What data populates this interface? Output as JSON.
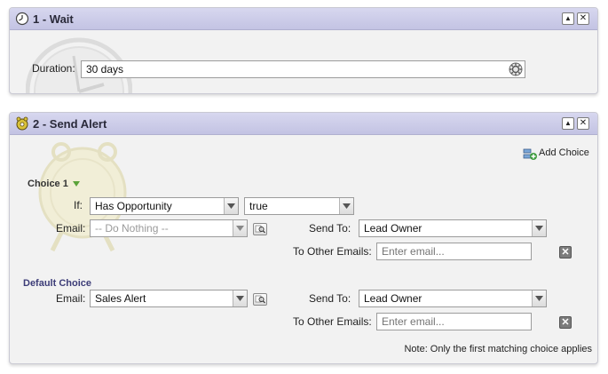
{
  "wait_panel": {
    "title": "1 - Wait",
    "minimize_glyph": "▲",
    "close_glyph": "✕",
    "duration_label": "Duration:",
    "duration_value": "30 days",
    "icons": [
      "clock-icon",
      "gear-icon"
    ]
  },
  "alert_panel": {
    "title": "2 - Send Alert",
    "minimize_glyph": "▲",
    "close_glyph": "✕",
    "add_choice_label": "Add Choice",
    "choice1": {
      "heading": "Choice 1",
      "if_label": "If:",
      "if_condition": "Has Opportunity",
      "if_value": "true",
      "email_label": "Email:",
      "email_value": "-- Do Nothing --",
      "send_to_label": "Send To:",
      "send_to_value": "Lead Owner",
      "other_emails_label": "To Other Emails:",
      "other_emails_placeholder": "Enter email..."
    },
    "default_choice": {
      "heading": "Default Choice",
      "email_label": "Email:",
      "email_value": "Sales Alert",
      "send_to_label": "Send To:",
      "send_to_value": "Lead Owner",
      "other_emails_label": "To Other Emails:",
      "other_emails_placeholder": "Enter email..."
    },
    "note": "Note: Only the first matching choice applies",
    "remove_glyph": "✕",
    "icons": [
      "alarm-bell-icon",
      "add-choice-icon",
      "preview-search-icon",
      "remove-icon"
    ]
  },
  "colors": {
    "header_bg": "#c8c8e6",
    "panel_bg": "#f2f2f2",
    "default_choice_heading": "#3d3d78"
  }
}
